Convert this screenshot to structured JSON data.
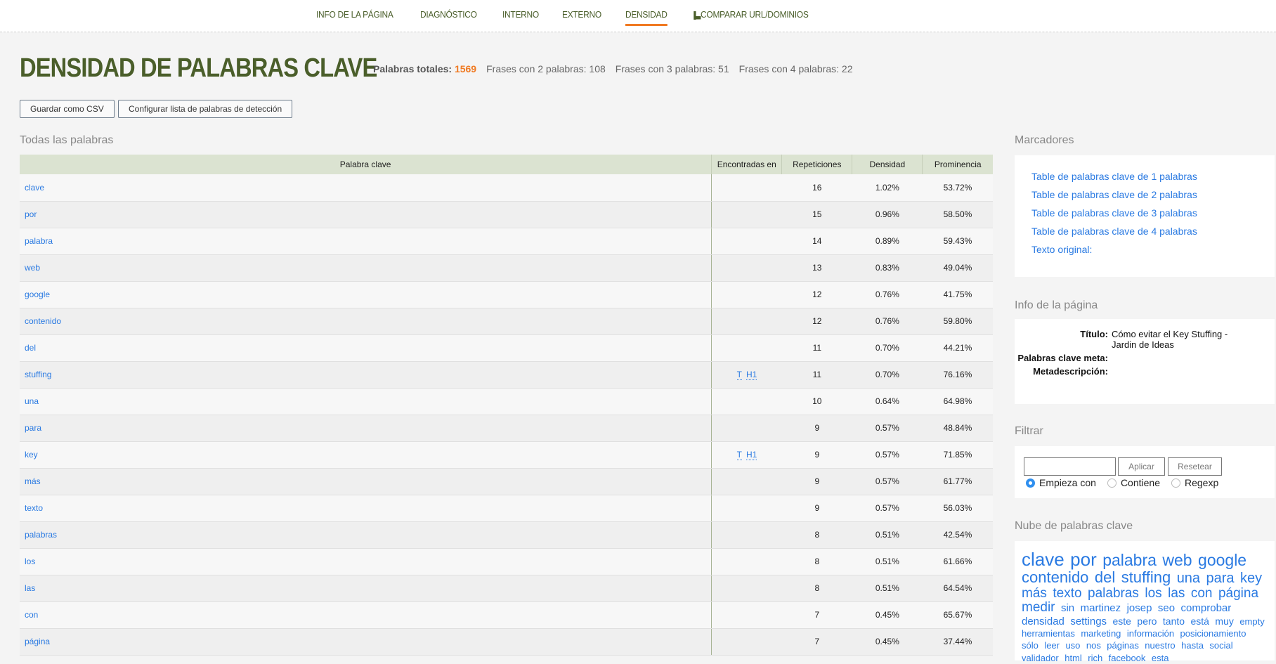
{
  "nav": {
    "items": [
      {
        "label": "INFO DE LA PÁGINA"
      },
      {
        "label": "DIAGNÓSTICO"
      },
      {
        "label": "INTERNO"
      },
      {
        "label": "EXTERNO"
      },
      {
        "label": "DENSIDAD",
        "active": true
      },
      {
        "label": "COMPARAR URL/DOMINIOS",
        "icon": "bar-chart-icon"
      }
    ]
  },
  "title": "DENSIDAD DE PALABRAS CLAVE",
  "stats": {
    "total_label": "Palabras totales:",
    "total": "1569",
    "two": "Frases con 2 palabras: 108",
    "three": "Frases con 3 palabras: 51",
    "four": "Frases con 4 palabras: 22"
  },
  "buttons": {
    "csv": "Guardar como CSV",
    "config": "Configurar lista de palabras de detección"
  },
  "table": {
    "heading": "Todas las palabras",
    "columns": [
      "Palabra clave",
      "Encontradas en",
      "Repeticiones",
      "Densidad",
      "Prominencia"
    ],
    "rows": [
      [
        "clave",
        "",
        "16",
        "1.02%",
        "53.72%"
      ],
      [
        "por",
        "",
        "15",
        "0.96%",
        "58.50%"
      ],
      [
        "palabra",
        "",
        "14",
        "0.89%",
        "59.43%"
      ],
      [
        "web",
        "",
        "13",
        "0.83%",
        "49.04%"
      ],
      [
        "google",
        "",
        "12",
        "0.76%",
        "41.75%"
      ],
      [
        "contenido",
        "",
        "12",
        "0.76%",
        "59.80%"
      ],
      [
        "del",
        "",
        "11",
        "0.70%",
        "44.21%"
      ],
      [
        "stuffing",
        "T H1",
        "11",
        "0.70%",
        "76.16%"
      ],
      [
        "una",
        "",
        "10",
        "0.64%",
        "64.98%"
      ],
      [
        "para",
        "",
        "9",
        "0.57%",
        "48.84%"
      ],
      [
        "key",
        "T H1",
        "9",
        "0.57%",
        "71.85%"
      ],
      [
        "más",
        "",
        "9",
        "0.57%",
        "61.77%"
      ],
      [
        "texto",
        "",
        "9",
        "0.57%",
        "56.03%"
      ],
      [
        "palabras",
        "",
        "8",
        "0.51%",
        "42.54%"
      ],
      [
        "los",
        "",
        "8",
        "0.51%",
        "61.66%"
      ],
      [
        "las",
        "",
        "8",
        "0.51%",
        "64.54%"
      ],
      [
        "con",
        "",
        "7",
        "0.45%",
        "65.67%"
      ],
      [
        "página",
        "",
        "7",
        "0.45%",
        "37.44%"
      ]
    ]
  },
  "markers": {
    "heading": "Marcadores",
    "links": [
      "Table de palabras clave de 1 palabras",
      "Table de palabras clave de 2 palabras",
      "Table de palabras clave de 3 palabras",
      "Table de palabras clave de 4 palabras",
      "Texto original:"
    ]
  },
  "page_info": {
    "heading": "Info de la página",
    "title_label": "Título:",
    "title_value": "Cómo evitar el Key Stuffing - Jardin de Ideas",
    "keywords_label": "Palabras clave meta:",
    "keywords_value": "",
    "desc_label": "Metadescripción:",
    "desc_value": ""
  },
  "filter": {
    "heading": "Filtrar",
    "value": "",
    "apply": "Aplicar",
    "reset": "Resetear",
    "options": [
      "Empieza con",
      "Contiene",
      "Regexp"
    ],
    "selected": "Empieza con"
  },
  "cloud": {
    "heading": "Nube de palabras clave",
    "lines": [
      {
        "size": 26,
        "words": [
          "clave",
          "por"
        ]
      },
      {
        "size": 23,
        "words": [
          "palabra",
          "web",
          "google"
        ]
      },
      {
        "size": 22,
        "words": [
          "contenido",
          "del",
          "stuffing"
        ]
      },
      {
        "size": 20,
        "words": [
          "una",
          "para",
          "key"
        ]
      },
      {
        "size": 19,
        "words": [
          "más",
          "texto",
          "palabras",
          "los",
          "las",
          "con",
          "página",
          "medir"
        ]
      },
      {
        "size": 15,
        "words": [
          "sin",
          "martinez",
          "josep",
          "seo",
          "comprobar",
          "densidad",
          "settings"
        ]
      },
      {
        "size": 14,
        "words": [
          "este",
          "pero",
          "tanto",
          "está",
          "muy"
        ]
      },
      {
        "size": 13,
        "words": [
          "empty",
          "herramientas",
          "marketing",
          "información",
          "posicionamiento",
          "sólo",
          "leer",
          "uso",
          "nos",
          "páginas",
          "nuestro",
          "hasta",
          "social",
          "validador",
          "html",
          "rich",
          "facebook",
          "esta"
        ]
      }
    ]
  },
  "colors": {
    "brand": "#4a5e2a",
    "accent": "#f07a22",
    "link": "#2a7ae2"
  }
}
